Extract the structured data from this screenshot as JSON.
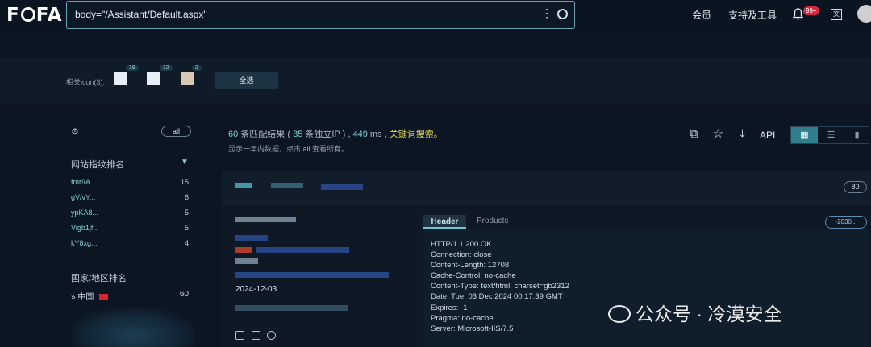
{
  "topbar": {
    "logo": "FOFA",
    "search_query": "body=\"/Assistant/Default.aspx\"",
    "member": "会员",
    "tools": "支持及工具",
    "notif_badge": "99+"
  },
  "icon_bar": {
    "label": "相关icon(3):",
    "icons": [
      {
        "count": "19"
      },
      {
        "count": "12"
      },
      {
        "count": "2"
      }
    ],
    "select_all": "全选"
  },
  "sidebar": {
    "all_pill": "all",
    "fingerprint_title": "网站指纹排名",
    "fingerprints": [
      {
        "key": "fmr9A...",
        "value": "15"
      },
      {
        "key": "gV/vY...",
        "value": "6"
      },
      {
        "key": "ypKA8...",
        "value": "5"
      },
      {
        "key": "Vigb1jf...",
        "value": "5"
      },
      {
        "key": "kY8xg...",
        "value": "4"
      }
    ],
    "region_title": "国家/地区排名",
    "country": {
      "name": "中国",
      "value": "60"
    }
  },
  "summary": {
    "count": "60",
    "t1": " 条匹配结果 ( ",
    "ips": "35",
    "t2": " 条独立IP ) , ",
    "ms": "449",
    "t3": " ms , ",
    "keyword": "关键词搜索。",
    "note_pre": "显示一年内数据，点击 ",
    "note_all": "all",
    "note_post": " 查看所有。",
    "api": "API"
  },
  "result": {
    "port": "80",
    "date": "2024-12-03",
    "tabs": {
      "header": "Header",
      "products": "Products"
    },
    "version_pill": "-2030...",
    "headers": [
      "HTTP/1.1 200 OK",
      "Connection: close",
      "Content-Length: 12708",
      "Cache-Control: no-cache",
      "Content-Type: text/html; charset=gb2312",
      "Date: Tue, 03 Dec 2024 00:17:39 GMT",
      "Expires: -1",
      "Pragma: no-cache",
      "Server: Microsoft-IIS/7.5"
    ]
  },
  "watermark": "公众号 · 冷漠安全"
}
